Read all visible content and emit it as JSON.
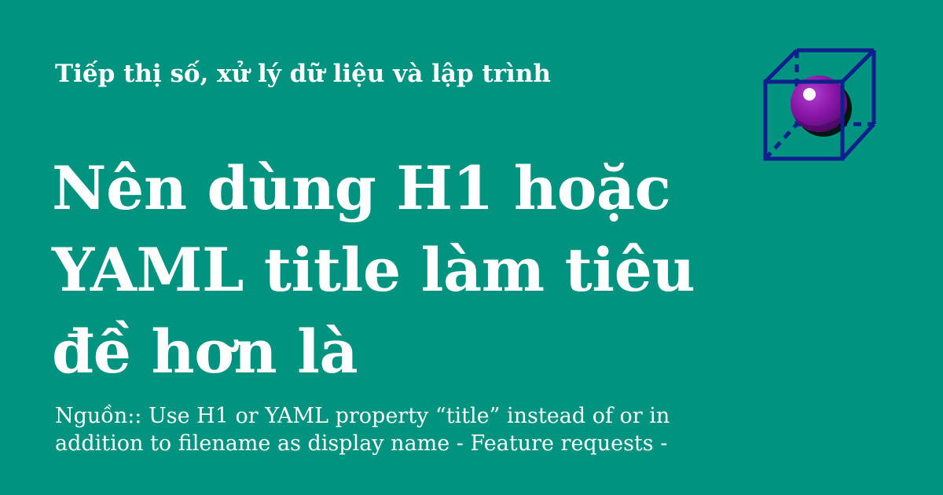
{
  "colors": {
    "background": "#00937f",
    "text": "#ffffff",
    "cube_stroke": "#0f1f8c",
    "sphere": "#8a16a8",
    "sphere_dark": "#4a0a62"
  },
  "header": {
    "category": "Tiếp thị số, xử lý dữ liệu và lập trình",
    "logo_icon": "cube-sphere-icon"
  },
  "main": {
    "title": "Nên dùng H1 hoặc YAML title làm tiêu đề hơn là",
    "source": "Nguồn:: Use H1 or YAML property “title” instead of or in addition to filename as display name - Feature requests -"
  }
}
